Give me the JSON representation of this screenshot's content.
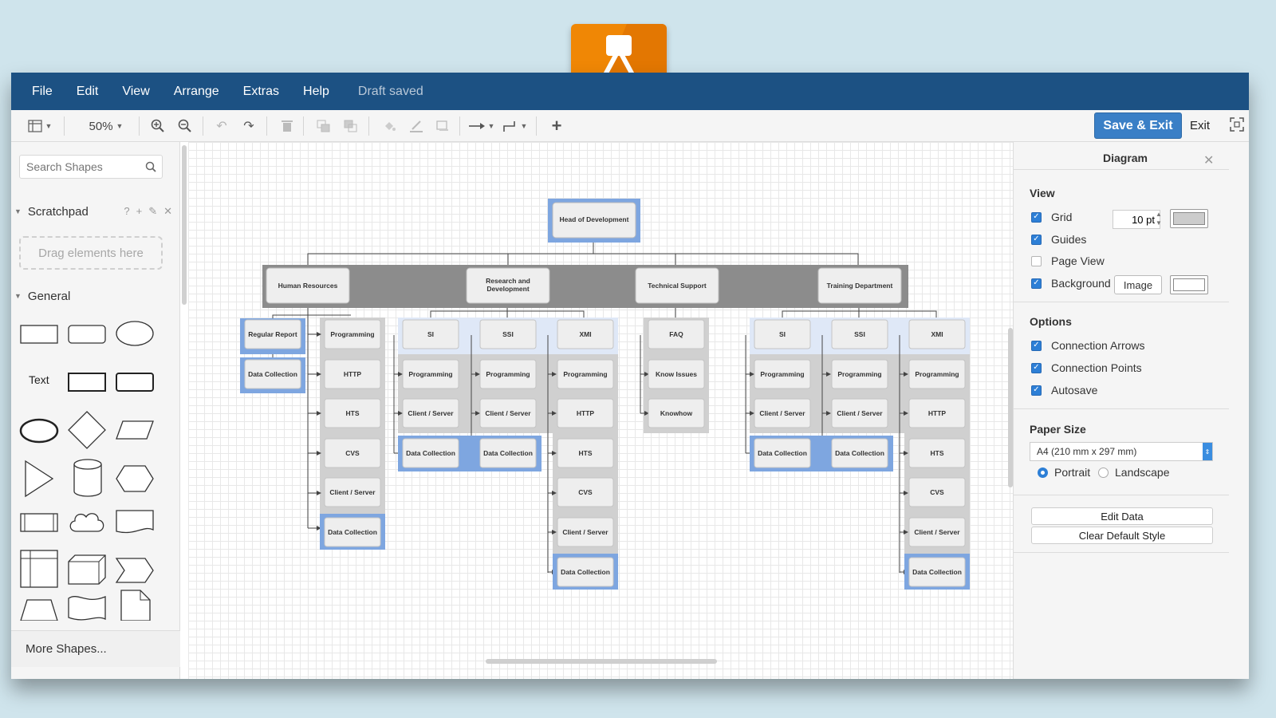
{
  "menubar": {
    "items": [
      "File",
      "Edit",
      "View",
      "Arrange",
      "Extras",
      "Help"
    ],
    "status": "Draft saved"
  },
  "toolbar": {
    "zoom": "50%",
    "save_exit_label": "Save & Exit",
    "exit_label": "Exit",
    "icons": [
      "panel-toggle-icon",
      "zoom-in-icon",
      "zoom-out-icon",
      "undo-icon",
      "redo-icon",
      "delete-icon",
      "to-front-icon",
      "to-back-icon",
      "fill-color-icon",
      "line-color-icon",
      "shadow-icon",
      "connection-icon",
      "waypoints-icon",
      "insert-icon",
      "fullscreen-icon"
    ]
  },
  "sidebar": {
    "search_placeholder": "Search Shapes",
    "scratchpad": {
      "title": "Scratchpad",
      "tools": [
        "?",
        "+",
        "✎",
        "✕"
      ],
      "drop_hint": "Drag elements here"
    },
    "general_title": "General",
    "text_shape_label": "Text",
    "more_shapes": "More Shapes..."
  },
  "diagram": {
    "root": "Head of Development",
    "departments": [
      "Human Resources",
      "Research and Development",
      "Technical Support",
      "Training Department"
    ],
    "hr": {
      "left": [
        "Regular Report",
        "Data Collection"
      ],
      "right": [
        "Programming",
        "HTTP",
        "HTS",
        "CVS",
        "Client / Server",
        "Data Collection"
      ]
    },
    "rnd": {
      "si": [
        "SI",
        "Programming",
        "Client / Server",
        "Data Collection"
      ],
      "ssi": [
        "SSI",
        "Programming",
        "Client / Server",
        "Data Collection"
      ],
      "xmi": [
        "XMI",
        "Programming",
        "HTTP",
        "HTS",
        "CVS",
        "Client / Server",
        "Data Collection"
      ]
    },
    "support": [
      "FAQ",
      "Know Issues",
      "Knowhow"
    ],
    "training": {
      "si": [
        "SI",
        "Programming",
        "Client / Server",
        "Data Collection"
      ],
      "ssi": [
        "SSI",
        "Programming",
        "Client / Server",
        "Data Collection"
      ],
      "xmi": [
        "XMI",
        "Programming",
        "HTTP",
        "HTS",
        "CVS",
        "Client / Server",
        "Data Collection"
      ]
    }
  },
  "format_panel": {
    "title": "Diagram",
    "view_heading": "View",
    "view_options": [
      {
        "label": "Grid",
        "checked": true
      },
      {
        "label": "Guides",
        "checked": true
      },
      {
        "label": "Page View",
        "checked": false
      },
      {
        "label": "Background",
        "checked": true
      }
    ],
    "grid_size": "10 pt",
    "grid_color": "#cccccc",
    "background_color": "#ffffff",
    "image_button": "Image",
    "options_heading": "Options",
    "options": [
      {
        "label": "Connection Arrows",
        "checked": true
      },
      {
        "label": "Connection Points",
        "checked": true
      },
      {
        "label": "Autosave",
        "checked": true
      }
    ],
    "paper_heading": "Paper Size",
    "paper_size": "A4 (210 mm x 297 mm)",
    "orientation": {
      "portrait": "Portrait",
      "landscape": "Landscape",
      "selected": "Portrait"
    },
    "edit_data": "Edit Data",
    "clear_style": "Clear Default Style"
  },
  "colors": {
    "menubar": "#1c5183",
    "accent": "#3a7fc6",
    "logo": "#f08705",
    "selection": "#7ea6e0",
    "group_fill": "#8c8c8c",
    "lane_fill": "#d0d0d0"
  }
}
